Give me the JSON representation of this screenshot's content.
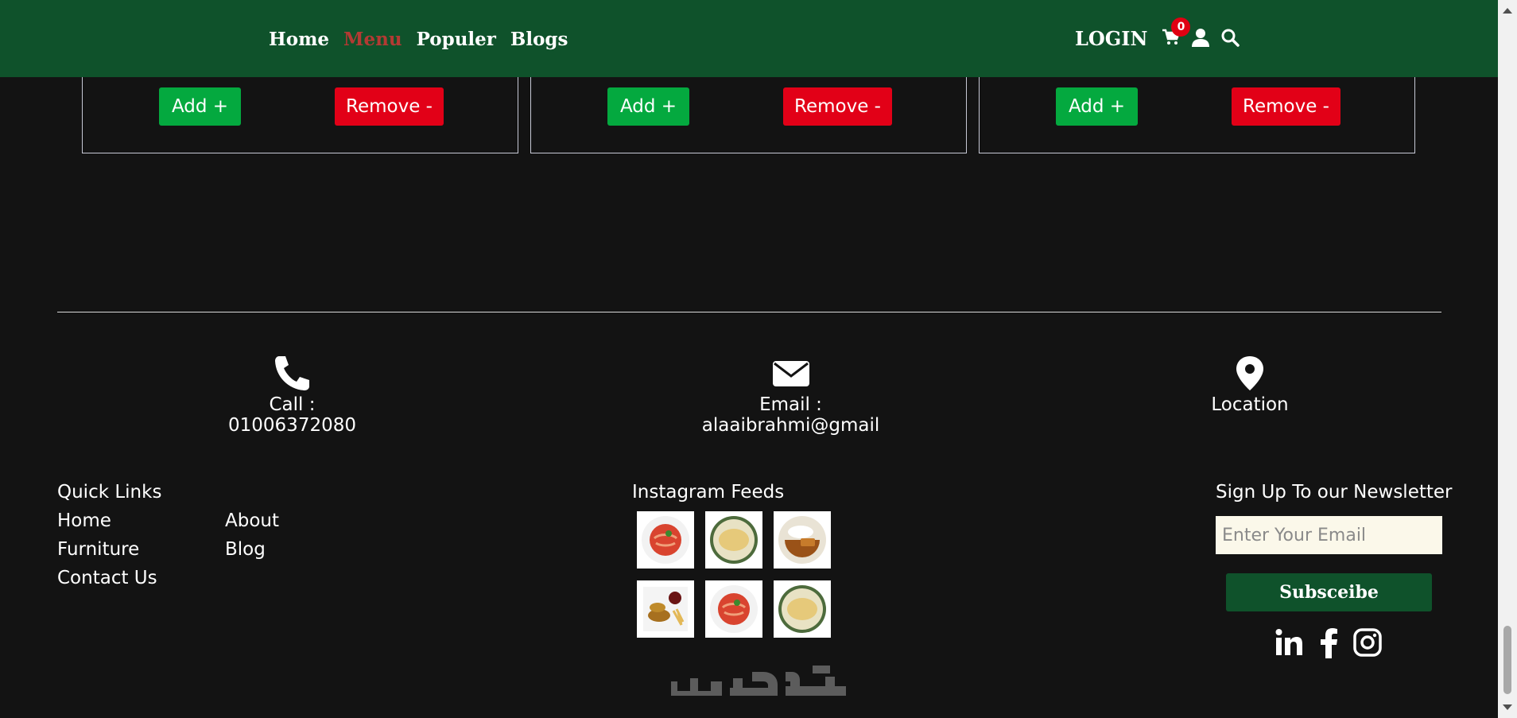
{
  "nav": {
    "links": [
      "Home",
      "Menu",
      "Populer",
      "Blogs"
    ],
    "active": "Menu",
    "login": "LOGIN",
    "cart_count": "0",
    "icons": [
      "cart-icon",
      "user-icon",
      "search-icon"
    ]
  },
  "cards": [
    {
      "add": "Add +",
      "remove": "Remove -"
    },
    {
      "add": "Add +",
      "remove": "Remove -"
    },
    {
      "add": "Add +",
      "remove": "Remove -"
    }
  ],
  "contact": {
    "call": "Call : 01006372080",
    "email": "Email : alaaibrahmi@gmail",
    "location": "Location"
  },
  "footer": {
    "quick_links_title": "Quick Links",
    "links_col1": [
      "Home",
      "Furniture",
      "Contact Us"
    ],
    "links_col2": [
      "About",
      "Blog"
    ],
    "instagram_title": "Instagram Feeds",
    "instagram_images": [
      "pasta-dish",
      "omelette-dish",
      "curry-rice-dish",
      "fried-chicken-fries-dish",
      "pasta-dish",
      "omelette-dish"
    ],
    "newsletter_title": "Sign Up To our Newsletter",
    "email_placeholder": "Enter Your Email",
    "subscribe": "Subsceibe",
    "social_icons": [
      "linkedin-icon",
      "facebook-icon",
      "instagram-icon"
    ]
  },
  "watermark": "خمسات",
  "colors": {
    "nav_bg": "#0f522b",
    "page_bg": "#131313",
    "active_link": "#b33a33",
    "add_button": "#04a93f",
    "remove_button": "#e20017",
    "badge": "#e00012",
    "input_bg": "#fbf8ea"
  }
}
